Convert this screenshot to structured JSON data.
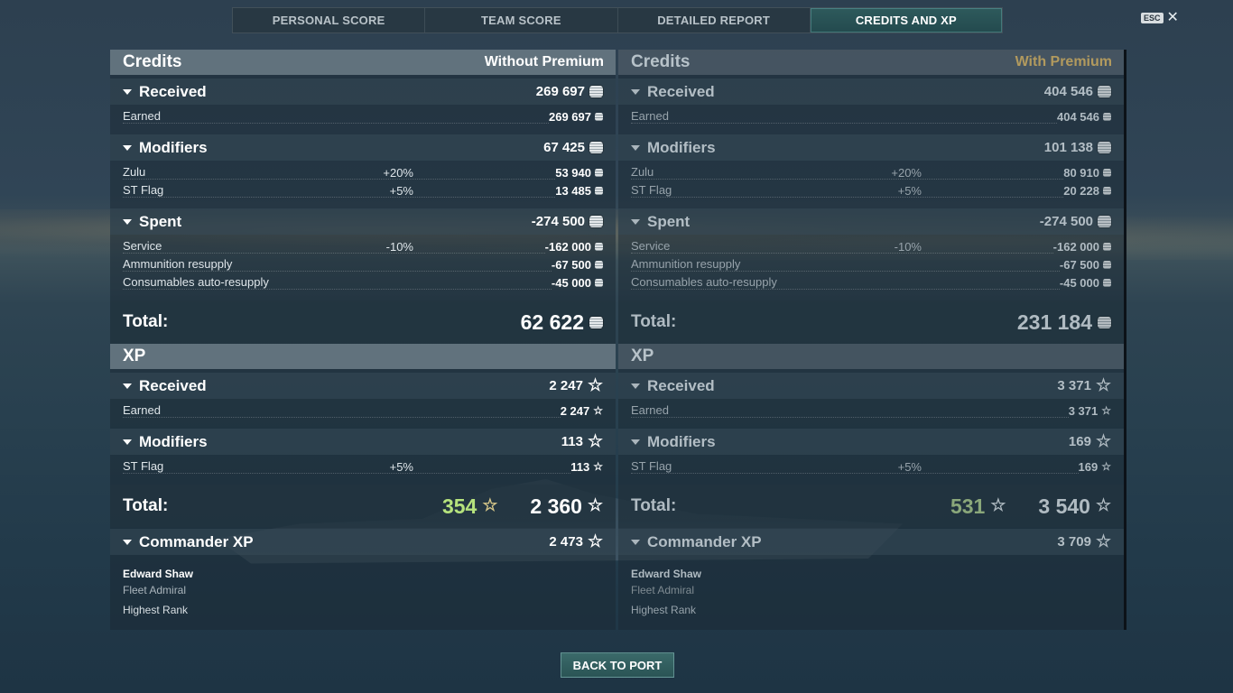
{
  "tabs": [
    "PERSONAL SCORE",
    "TEAM SCORE",
    "DETAILED REPORT",
    "CREDITS AND XP"
  ],
  "esc_label": "ESC",
  "close_glyph": "✕",
  "left": {
    "credits_title": "Credits",
    "mode": "Without Premium",
    "received": {
      "label": "Received",
      "value": "269 697"
    },
    "earned": {
      "label": "Earned",
      "value": "269 697"
    },
    "modifiers": {
      "label": "Modifiers",
      "value": "67 425"
    },
    "zulu": {
      "label": "Zulu",
      "pct": "+20%",
      "value": "53 940"
    },
    "stflag": {
      "label": "ST Flag",
      "pct": "+5%",
      "value": "13 485"
    },
    "spent": {
      "label": "Spent",
      "value": "-274 500"
    },
    "service": {
      "label": "Service",
      "pct": "-10%",
      "value": "-162 000"
    },
    "ammo": {
      "label": "Ammunition resupply",
      "value": "-67 500"
    },
    "consumables": {
      "label": "Consumables auto-resupply",
      "value": "-45 000"
    },
    "credits_total": {
      "label": "Total:",
      "value": "62 622"
    },
    "xp_title": "XP",
    "xp_received": {
      "label": "Received",
      "value": "2 247"
    },
    "xp_earned": {
      "label": "Earned",
      "value": "2 247"
    },
    "xp_modifiers": {
      "label": "Modifiers",
      "value": "113"
    },
    "xp_stflag": {
      "label": "ST Flag",
      "pct": "+5%",
      "value": "113"
    },
    "xp_total": {
      "label": "Total:",
      "free": "354",
      "value": "2 360"
    },
    "commander_xp": {
      "label": "Commander XP",
      "value": "2 473"
    },
    "commander": {
      "name": "Edward Shaw",
      "rank": "Fleet Admiral",
      "highest": "Highest Rank"
    }
  },
  "right": {
    "credits_title": "Credits",
    "mode": "With Premium",
    "received": {
      "label": "Received",
      "value": "404 546"
    },
    "earned": {
      "label": "Earned",
      "value": "404 546"
    },
    "modifiers": {
      "label": "Modifiers",
      "value": "101 138"
    },
    "zulu": {
      "label": "Zulu",
      "pct": "+20%",
      "value": "80 910"
    },
    "stflag": {
      "label": "ST Flag",
      "pct": "+5%",
      "value": "20 228"
    },
    "spent": {
      "label": "Spent",
      "value": "-274 500"
    },
    "service": {
      "label": "Service",
      "pct": "-10%",
      "value": "-162 000"
    },
    "ammo": {
      "label": "Ammunition resupply",
      "value": "-67 500"
    },
    "consumables": {
      "label": "Consumables auto-resupply",
      "value": "-45 000"
    },
    "credits_total": {
      "label": "Total:",
      "value": "231 184"
    },
    "xp_title": "XP",
    "xp_received": {
      "label": "Received",
      "value": "3 371"
    },
    "xp_earned": {
      "label": "Earned",
      "value": "3 371"
    },
    "xp_modifiers": {
      "label": "Modifiers",
      "value": "169"
    },
    "xp_stflag": {
      "label": "ST Flag",
      "pct": "+5%",
      "value": "169"
    },
    "xp_total": {
      "label": "Total:",
      "free": "531",
      "value": "3 540"
    },
    "commander_xp": {
      "label": "Commander XP",
      "value": "3 709"
    },
    "commander": {
      "name": "Edward Shaw",
      "rank": "Fleet Admiral",
      "highest": "Highest Rank"
    }
  },
  "back_button": "BACK TO PORT",
  "icons": {
    "credits": "credits-coin-icon",
    "xp": "xp-star-icon",
    "expand": "triangle-down-icon",
    "close": "close-icon"
  },
  "colors": {
    "active_tab": "#2e5a5c",
    "free_xp": "#b6e37d",
    "premium_label": "#b29a5e"
  }
}
